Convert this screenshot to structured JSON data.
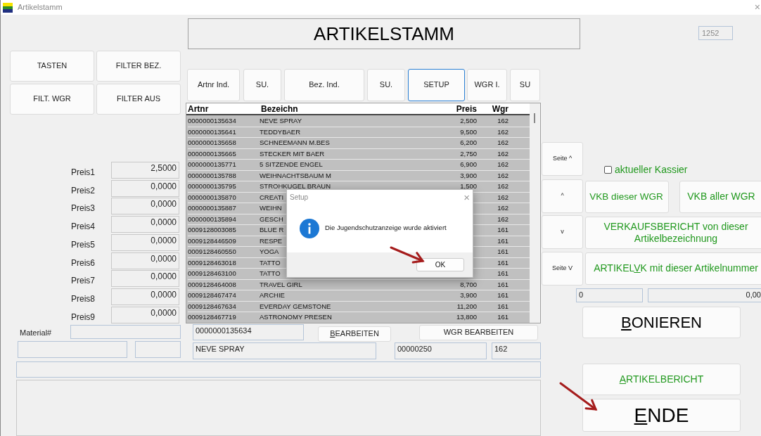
{
  "window": {
    "title": "Artikelstamm",
    "close": "×"
  },
  "header": "ARTIKELSTAMM",
  "counter": "1252",
  "filter_buttons": [
    "TASTEN",
    "FILTER BEZ.",
    "FILT. WGR",
    "FILTER AUS"
  ],
  "tabs": [
    {
      "label": "Artnr Ind.",
      "selected": false
    },
    {
      "label": "SU.",
      "selected": false
    },
    {
      "label": "Bez. Ind.",
      "selected": false
    },
    {
      "label": "SU.",
      "selected": false
    },
    {
      "label": "SETUP",
      "selected": true
    },
    {
      "label": "WGR I.",
      "selected": false
    },
    {
      "label": "SU",
      "selected": false
    }
  ],
  "table": {
    "columns": [
      "Artnr",
      "Bezeichn",
      "Preis",
      "Wgr"
    ],
    "rows": [
      {
        "artnr": "0000000135634",
        "bezeichn": "NEVE SPRAY",
        "preis": "2,500",
        "wgr": "162"
      },
      {
        "artnr": "0000000135641",
        "bezeichn": "TEDDYBAER",
        "preis": "9,500",
        "wgr": "162"
      },
      {
        "artnr": "0000000135658",
        "bezeichn": "SCHNEEMANN M.BES",
        "preis": "6,200",
        "wgr": "162"
      },
      {
        "artnr": "0000000135665",
        "bezeichn": "STECKER MIT BAER",
        "preis": "2,750",
        "wgr": "162"
      },
      {
        "artnr": "0000000135771",
        "bezeichn": "5 SITZENDE ENGEL",
        "preis": "6,900",
        "wgr": "162"
      },
      {
        "artnr": "0000000135788",
        "bezeichn": "WEIHNACHTSBAUM M",
        "preis": "3,900",
        "wgr": "162"
      },
      {
        "artnr": "0000000135795",
        "bezeichn": "STROHKUGEL BRAUN",
        "preis": "1,500",
        "wgr": "162"
      },
      {
        "artnr": "0000000135870",
        "bezeichn": "CREATI",
        "wgr": "162"
      },
      {
        "artnr": "0000000135887",
        "bezeichn": "WEIHN",
        "wgr": "162"
      },
      {
        "artnr": "0000000135894",
        "bezeichn": "GESCH",
        "wgr": "162"
      },
      {
        "artnr": "0009128003085",
        "bezeichn": "BLUE R",
        "wgr": "161"
      },
      {
        "artnr": "0009128446509",
        "bezeichn": "RESPE",
        "wgr": "161"
      },
      {
        "artnr": "0009128460550",
        "bezeichn": "YOGA",
        "wgr": "161"
      },
      {
        "artnr": "0009128463018",
        "bezeichn": "TATTO",
        "wgr": "161"
      },
      {
        "artnr": "0009128463100",
        "bezeichn": "TATTO",
        "wgr": "161"
      },
      {
        "artnr": "0009128464008",
        "bezeichn": "TRAVEL GIRL",
        "preis": "8,700",
        "wgr": "161"
      },
      {
        "artnr": "0009128467474",
        "bezeichn": "ARCHIE",
        "preis": "3,900",
        "wgr": "161"
      },
      {
        "artnr": "0009128467634",
        "bezeichn": "EVERDAY GEMSTONE",
        "preis": "11,200",
        "wgr": "161"
      },
      {
        "artnr": "0009128467719",
        "bezeichn": "ASTRONOMY PRESEN",
        "preis": "13,800",
        "wgr": "161"
      }
    ]
  },
  "prices": [
    {
      "label": "Preis1",
      "value": "2,5000"
    },
    {
      "label": "Preis2",
      "value": "0,0000"
    },
    {
      "label": "Preis3",
      "value": "0,0000"
    },
    {
      "label": "Preis4",
      "value": "0,0000"
    },
    {
      "label": "Preis5",
      "value": "0,0000"
    },
    {
      "label": "Preis6",
      "value": "0,0000"
    },
    {
      "label": "Preis7",
      "value": "0,0000"
    },
    {
      "label": "Preis8",
      "value": "0,0000"
    },
    {
      "label": "Preis9",
      "value": "0,0000"
    }
  ],
  "material_label": "Material#",
  "artnr_field": "0000000135634",
  "bearbeiten": {
    "key": "B",
    "post": "EARBEITEN"
  },
  "wgr_bearbeiten": "WGR BEARBEITEN",
  "name_field": "NEVE SPRAY",
  "code_field": "00000250",
  "wgr_field": "162",
  "nav_buttons": [
    "Seite ^",
    "^",
    "v",
    "Seite V"
  ],
  "kassier": {
    "label": "aktueller Kassier",
    "checked": false
  },
  "report_buttons": [
    {
      "post": "VKB dieser WGR"
    },
    {
      "post": "VKB aller WGR"
    },
    {
      "post": "VERKAUFSBERICHT von dieser Artikelbezeichnung"
    },
    {
      "pre": "ARTIKEL",
      "key": "V",
      "post": "K mit dieser Artikelnummer"
    }
  ],
  "count_field": "0",
  "sum_field": "0,00",
  "bonieren": {
    "key": "B",
    "post": "ONIEREN"
  },
  "artikelbericht": {
    "key": "A",
    "post": "RTIKELBERICHT"
  },
  "ende": {
    "key": "E",
    "post": "NDE"
  },
  "dialog": {
    "title": "Setup",
    "close": "×",
    "message": "Die Jugendschutzanzeige wurde aktiviert",
    "button": "OK"
  }
}
